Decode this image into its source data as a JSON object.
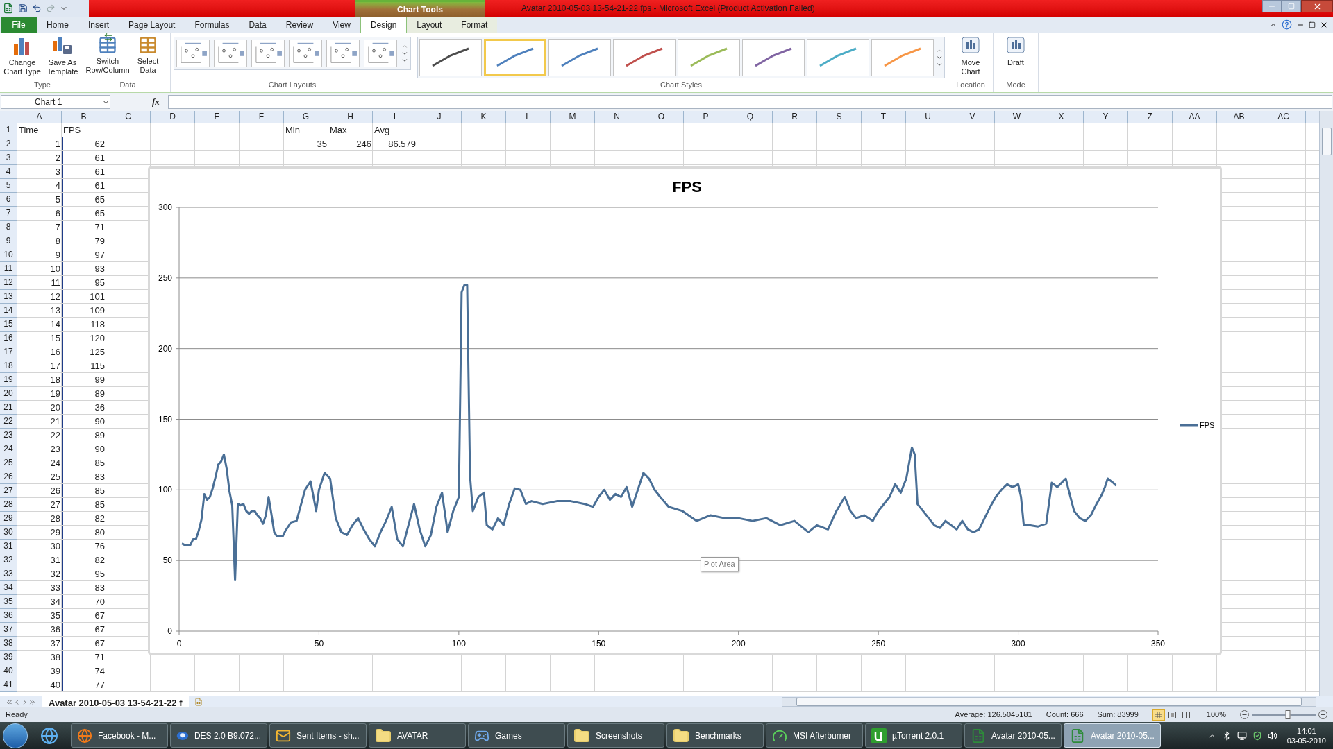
{
  "window": {
    "title": "Avatar 2010-05-03 13-54-21-22 fps  -  Microsoft Excel (Product Activation Failed)",
    "context_group": "Chart Tools"
  },
  "ribbon_tabs": [
    {
      "label": "File",
      "kind": "file",
      "selected": false
    },
    {
      "label": "Home",
      "kind": "tab",
      "selected": false
    },
    {
      "label": "Insert",
      "kind": "tab",
      "selected": false
    },
    {
      "label": "Page Layout",
      "kind": "tab",
      "selected": false
    },
    {
      "label": "Formulas",
      "kind": "tab",
      "selected": false
    },
    {
      "label": "Data",
      "kind": "tab",
      "selected": false
    },
    {
      "label": "Review",
      "kind": "tab",
      "selected": false
    },
    {
      "label": "View",
      "kind": "tab",
      "selected": false
    },
    {
      "label": "Design",
      "kind": "context",
      "selected": true
    },
    {
      "label": "Layout",
      "kind": "context",
      "selected": false
    },
    {
      "label": "Format",
      "kind": "context",
      "selected": false
    }
  ],
  "ribbon_groups": [
    {
      "label": "Type",
      "kind": "buttons",
      "buttons": [
        {
          "label": "Change Chart Type",
          "kind": "bars"
        },
        {
          "label": "Save As Template",
          "kind": "template"
        }
      ]
    },
    {
      "label": "Data",
      "kind": "buttons",
      "buttons": [
        {
          "label": "Switch Row/Column",
          "kind": "switch"
        },
        {
          "label": "Select Data",
          "kind": "table"
        }
      ]
    },
    {
      "label": "Chart Layouts",
      "kind": "layouts"
    },
    {
      "label": "Chart Styles",
      "kind": "styles"
    },
    {
      "label": "Location",
      "kind": "buttons",
      "buttons": [
        {
          "label": "Move Chart",
          "kind": "chart"
        }
      ]
    },
    {
      "label": "Mode",
      "kind": "buttons",
      "buttons": [
        {
          "label": "Draft",
          "kind": "chart"
        }
      ]
    }
  ],
  "chart_styles": [
    {
      "color": "#4d4d4d",
      "selected": false
    },
    {
      "color": "#4f81bd",
      "selected": true
    },
    {
      "color": "#4f81bd",
      "selected": false
    },
    {
      "color": "#c0504d",
      "selected": false
    },
    {
      "color": "#9bbb59",
      "selected": false
    },
    {
      "color": "#8064a2",
      "selected": false
    },
    {
      "color": "#4bacc6",
      "selected": false
    },
    {
      "color": "#f79646",
      "selected": false
    }
  ],
  "name_box": "Chart 1",
  "formula_label": "fx",
  "sheet": {
    "columns": [
      "A",
      "B",
      "C",
      "D",
      "E",
      "F",
      "G",
      "H",
      "I",
      "J",
      "K",
      "L",
      "M",
      "N",
      "O",
      "P",
      "Q",
      "R",
      "S",
      "T",
      "U",
      "V",
      "W",
      "X",
      "Y",
      "Z",
      "AA",
      "AB",
      "AC"
    ],
    "rows": [
      {
        "header": "1",
        "cells": {
          "A": "Time",
          "B": "FPS",
          "G": "Min",
          "H": "Max",
          "I": "Avg"
        }
      },
      {
        "header": "2",
        "cells": {
          "A": "1",
          "B": "62",
          "G": "35",
          "H": "246",
          "I": "86.579"
        }
      },
      {
        "header": "3",
        "cells": {
          "A": "2",
          "B": "61"
        }
      },
      {
        "header": "4",
        "cells": {
          "A": "3",
          "B": "61"
        }
      },
      {
        "header": "5",
        "cells": {
          "A": "4",
          "B": "61"
        }
      },
      {
        "header": "6",
        "cells": {
          "A": "5",
          "B": "65"
        }
      },
      {
        "header": "7",
        "cells": {
          "A": "6",
          "B": "65"
        }
      },
      {
        "header": "8",
        "cells": {
          "A": "7",
          "B": "71"
        }
      },
      {
        "header": "9",
        "cells": {
          "A": "8",
          "B": "79"
        }
      },
      {
        "header": "10",
        "cells": {
          "A": "9",
          "B": "97"
        }
      },
      {
        "header": "11",
        "cells": {
          "A": "10",
          "B": "93"
        }
      },
      {
        "header": "12",
        "cells": {
          "A": "11",
          "B": "95"
        }
      },
      {
        "header": "13",
        "cells": {
          "A": "12",
          "B": "101"
        }
      },
      {
        "header": "14",
        "cells": {
          "A": "13",
          "B": "109"
        }
      },
      {
        "header": "15",
        "cells": {
          "A": "14",
          "B": "118"
        }
      },
      {
        "header": "16",
        "cells": {
          "A": "15",
          "B": "120"
        }
      },
      {
        "header": "17",
        "cells": {
          "A": "16",
          "B": "125"
        }
      },
      {
        "header": "18",
        "cells": {
          "A": "17",
          "B": "115"
        }
      },
      {
        "header": "19",
        "cells": {
          "A": "18",
          "B": "99"
        }
      },
      {
        "header": "20",
        "cells": {
          "A": "19",
          "B": "89"
        }
      },
      {
        "header": "21",
        "cells": {
          "A": "20",
          "B": "36"
        }
      },
      {
        "header": "22",
        "cells": {
          "A": "21",
          "B": "90"
        }
      },
      {
        "header": "23",
        "cells": {
          "A": "22",
          "B": "89"
        }
      },
      {
        "header": "24",
        "cells": {
          "A": "23",
          "B": "90"
        }
      },
      {
        "header": "25",
        "cells": {
          "A": "24",
          "B": "85"
        }
      },
      {
        "header": "26",
        "cells": {
          "A": "25",
          "B": "83"
        }
      },
      {
        "header": "27",
        "cells": {
          "A": "26",
          "B": "85"
        }
      },
      {
        "header": "28",
        "cells": {
          "A": "27",
          "B": "85"
        }
      },
      {
        "header": "29",
        "cells": {
          "A": "28",
          "B": "82"
        }
      },
      {
        "header": "30",
        "cells": {
          "A": "29",
          "B": "80"
        }
      },
      {
        "header": "31",
        "cells": {
          "A": "30",
          "B": "76"
        }
      },
      {
        "header": "32",
        "cells": {
          "A": "31",
          "B": "82"
        }
      },
      {
        "header": "33",
        "cells": {
          "A": "32",
          "B": "95"
        }
      },
      {
        "header": "34",
        "cells": {
          "A": "33",
          "B": "83"
        }
      },
      {
        "header": "35",
        "cells": {
          "A": "34",
          "B": "70"
        }
      },
      {
        "header": "36",
        "cells": {
          "A": "35",
          "B": "67"
        }
      },
      {
        "header": "37",
        "cells": {
          "A": "36",
          "B": "67"
        }
      },
      {
        "header": "38",
        "cells": {
          "A": "37",
          "B": "67"
        }
      },
      {
        "header": "39",
        "cells": {
          "A": "38",
          "B": "71"
        }
      },
      {
        "header": "40",
        "cells": {
          "A": "39",
          "B": "74"
        }
      },
      {
        "header": "41",
        "cells": {
          "A": "40",
          "B": "77"
        }
      }
    ]
  },
  "chart": {
    "tooltip": "Plot Area",
    "chart_data": {
      "type": "line",
      "title": "FPS",
      "grid": true,
      "x": [
        1,
        2,
        3,
        4,
        5,
        6,
        7,
        8,
        9,
        10,
        11,
        12,
        13,
        14,
        15,
        16,
        17,
        18,
        19,
        20,
        21,
        22,
        23,
        24,
        25,
        26,
        27,
        28,
        29,
        30,
        31,
        32,
        33,
        34,
        35,
        36,
        37,
        38,
        39,
        40,
        42,
        45,
        47,
        49,
        50,
        52,
        54,
        56,
        58,
        60,
        62,
        64,
        66,
        68,
        70,
        72,
        74,
        76,
        78,
        80,
        82,
        84,
        86,
        88,
        90,
        92,
        94,
        96,
        98,
        100,
        101,
        102,
        103,
        104,
        105,
        107,
        109,
        110,
        112,
        114,
        116,
        118,
        120,
        122,
        124,
        126,
        130,
        135,
        140,
        145,
        148,
        150,
        152,
        154,
        156,
        158,
        160,
        162,
        164,
        166,
        168,
        170,
        172,
        175,
        180,
        185,
        190,
        195,
        200,
        205,
        210,
        215,
        220,
        225,
        228,
        232,
        235,
        238,
        240,
        242,
        245,
        248,
        250,
        252,
        254,
        256,
        258,
        260,
        262,
        263,
        264,
        266,
        268,
        270,
        272,
        274,
        276,
        278,
        280,
        282,
        284,
        286,
        288,
        290,
        292,
        294,
        296,
        298,
        300,
        301,
        302,
        304,
        307,
        310,
        312,
        314,
        316,
        317,
        318,
        320,
        322,
        324,
        326,
        328,
        330,
        331,
        332,
        334,
        335
      ],
      "series": [
        {
          "name": "FPS",
          "color": "#4a6f96",
          "values": [
            62,
            61,
            61,
            61,
            65,
            65,
            71,
            79,
            97,
            93,
            95,
            101,
            109,
            118,
            120,
            125,
            115,
            99,
            89,
            36,
            90,
            89,
            90,
            85,
            83,
            85,
            85,
            82,
            80,
            76,
            82,
            95,
            83,
            70,
            67,
            67,
            67,
            71,
            74,
            77,
            78,
            100,
            106,
            85,
            100,
            112,
            108,
            80,
            70,
            68,
            75,
            80,
            72,
            65,
            60,
            70,
            78,
            88,
            65,
            60,
            75,
            90,
            72,
            60,
            68,
            88,
            98,
            70,
            85,
            95,
            240,
            245,
            245,
            110,
            85,
            95,
            98,
            75,
            72,
            80,
            75,
            90,
            101,
            100,
            90,
            92,
            90,
            92,
            92,
            90,
            88,
            95,
            100,
            93,
            97,
            95,
            102,
            88,
            100,
            112,
            108,
            100,
            95,
            88,
            85,
            78,
            82,
            80,
            80,
            78,
            80,
            75,
            78,
            70,
            75,
            72,
            85,
            95,
            85,
            80,
            82,
            78,
            85,
            90,
            95,
            104,
            98,
            108,
            130,
            125,
            90,
            85,
            80,
            75,
            73,
            78,
            75,
            72,
            78,
            72,
            70,
            72,
            80,
            88,
            95,
            100,
            104,
            102,
            104,
            95,
            75,
            75,
            74,
            76,
            105,
            102,
            106,
            108,
            100,
            85,
            80,
            78,
            82,
            90,
            97,
            102,
            108,
            105,
            103
          ]
        }
      ],
      "xlim": [
        0,
        350
      ],
      "ylim": [
        0,
        300
      ],
      "xticks": [
        0,
        50,
        100,
        150,
        200,
        250,
        300,
        350
      ],
      "yticks": [
        0,
        50,
        100,
        150,
        200,
        250,
        300
      ]
    }
  },
  "sheet_tab": {
    "label": "Avatar 2010-05-03 13-54-21-22 f",
    "selected": true
  },
  "status_bar": {
    "mode": "Ready",
    "average": "Average: 126.5045181",
    "count": "Count: 666",
    "sum": "Sum: 83999",
    "views": [
      {
        "kind": "normal",
        "selected": true
      },
      {
        "kind": "page-layout",
        "selected": false
      },
      {
        "kind": "page-break",
        "selected": false
      }
    ],
    "zoom": "100%",
    "zoom_level": {
      "level": 0.56
    }
  },
  "taskbar": {
    "items": [
      {
        "label": "Facebook - M...",
        "kind": "browser",
        "active": false
      },
      {
        "label": "DES 2.0 B9.072...",
        "kind": "app",
        "active": false
      },
      {
        "label": "Sent Items - sh...",
        "kind": "mail",
        "active": false
      },
      {
        "label": "AVATAR",
        "kind": "folder",
        "active": false
      },
      {
        "label": "Games",
        "kind": "game",
        "active": false
      },
      {
        "label": "Screenshots",
        "kind": "folder",
        "active": false
      },
      {
        "label": "Benchmarks",
        "kind": "folder",
        "active": false
      },
      {
        "label": "MSI Afterburner",
        "kind": "gauge",
        "active": false
      },
      {
        "label": "µTorrent 2.0.1",
        "kind": "torrent",
        "active": false
      },
      {
        "label": "Avatar 2010-05...",
        "kind": "spreadsheet",
        "active": false
      },
      {
        "label": "Avatar 2010-05...",
        "kind": "spreadsheet",
        "active": true
      }
    ],
    "time": "14:01",
    "date": "03-05-2010"
  }
}
